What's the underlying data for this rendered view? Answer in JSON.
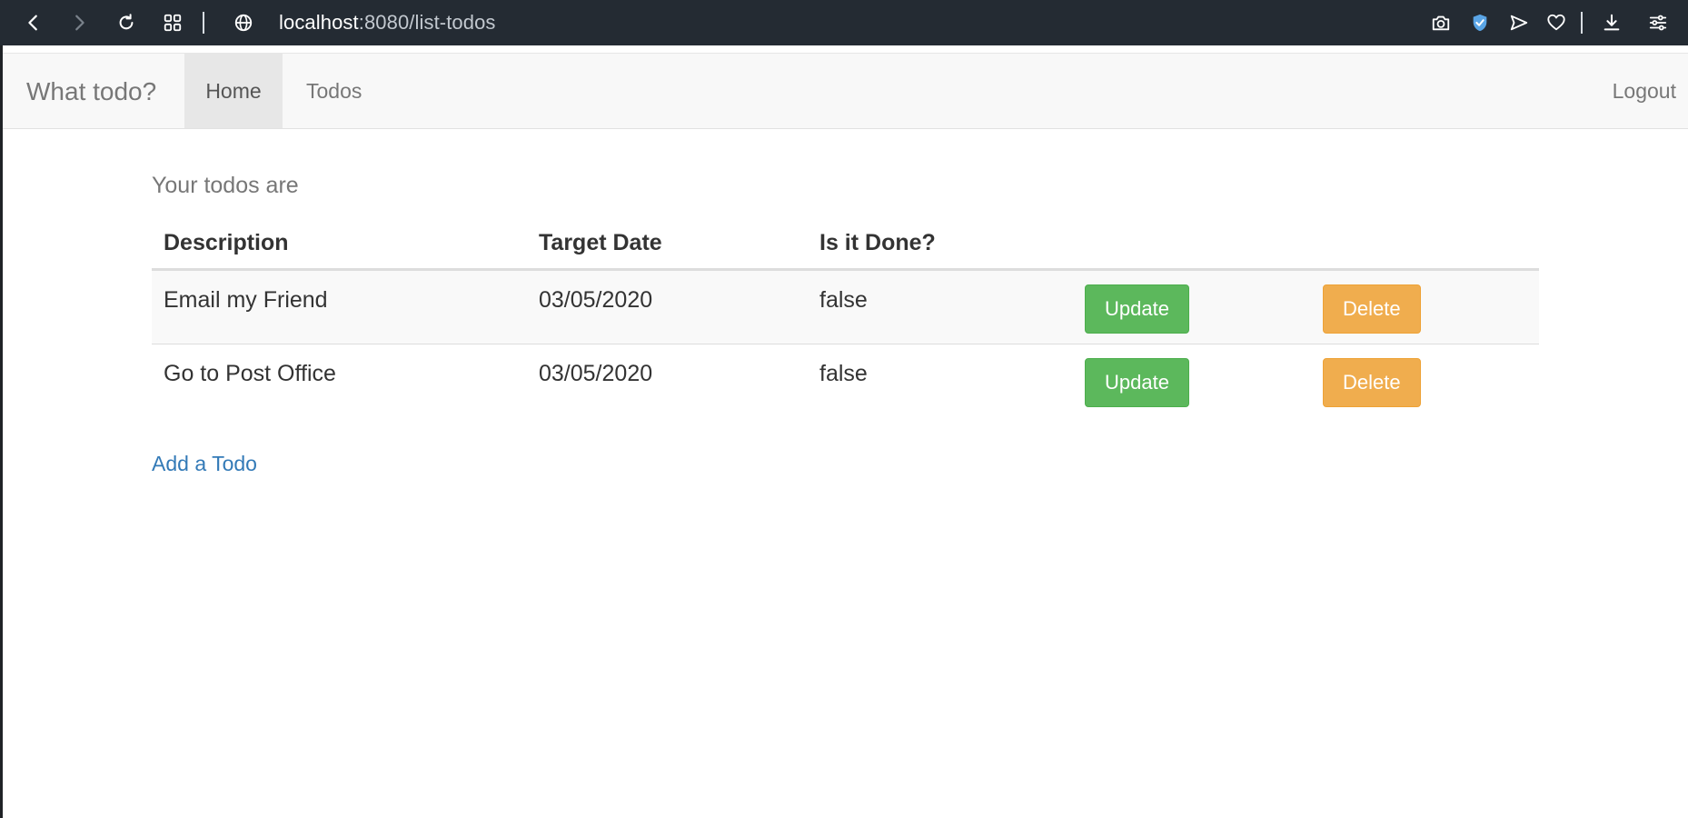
{
  "browser": {
    "url_host": "localhost",
    "url_rest": ":8080/list-todos",
    "accent_shield": "#5aa5e6"
  },
  "navbar": {
    "brand": "What todo?",
    "items": [
      {
        "label": "Home",
        "active": true
      },
      {
        "label": "Todos",
        "active": false
      }
    ],
    "logout": "Logout"
  },
  "main": {
    "caption": "Your todos are",
    "columns": [
      "Description",
      "Target Date",
      "Is it Done?"
    ],
    "rows": [
      {
        "description": "Email my Friend",
        "target_date": "03/05/2020",
        "done": "false",
        "update_label": "Update",
        "delete_label": "Delete"
      },
      {
        "description": "Go to Post Office",
        "target_date": "03/05/2020",
        "done": "false",
        "update_label": "Update",
        "delete_label": "Delete"
      }
    ],
    "add_link": "Add a Todo"
  },
  "colors": {
    "update": "#5cb85c",
    "delete": "#f0ad4e",
    "link": "#337ab7"
  }
}
